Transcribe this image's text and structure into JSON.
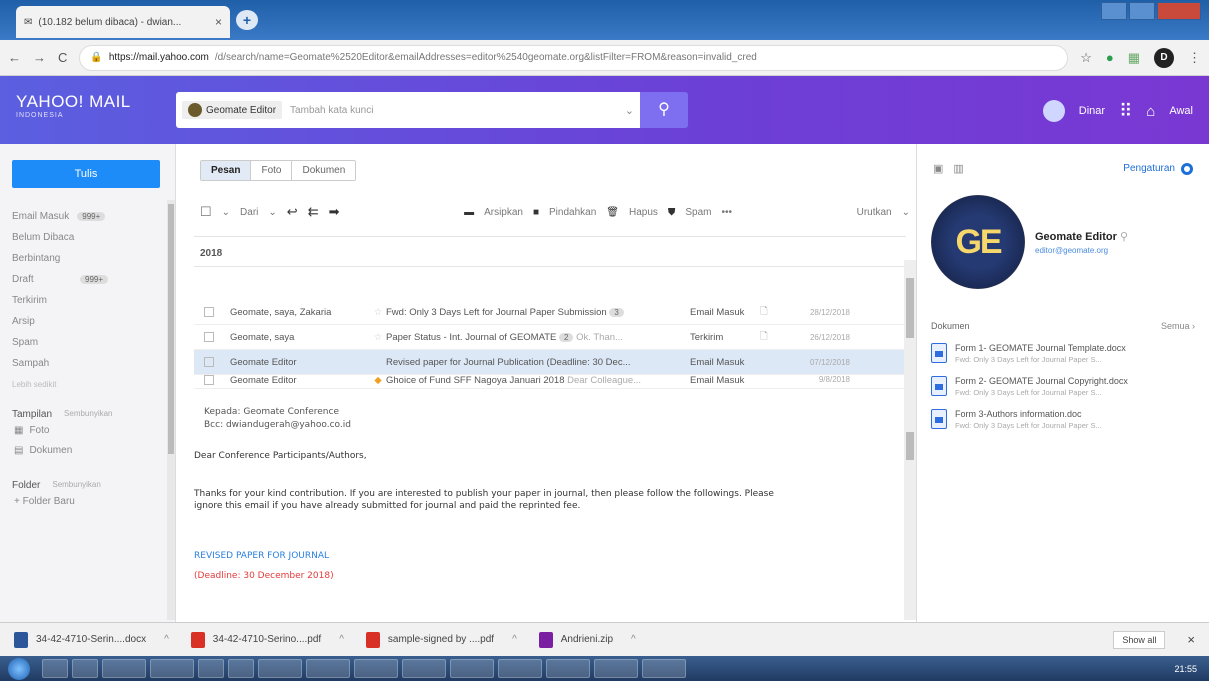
{
  "browser": {
    "tab_title": "(10.182 belum dibaca) - dwian...",
    "url_host": "https://mail.yahoo.com",
    "url_path": "/d/search/name=Geomate%2520Editor&emailAddresses=editor%2540geomate.org&listFilter=FROM&reason=invalid_cred",
    "profile_letter": "D"
  },
  "header": {
    "logo": "YAHOO! MAIL",
    "logo_sub": "INDONESIA",
    "search_chip": "Geomate Editor",
    "search_placeholder": "Tambah kata kunci",
    "user_name": "Dinar",
    "home_label": "Awal"
  },
  "sidebar": {
    "compose": "Tulis",
    "items": [
      {
        "label": "Email Masuk",
        "badge": "999+"
      },
      {
        "label": "Belum Dibaca",
        "badge": ""
      },
      {
        "label": "Berbintang",
        "badge": ""
      },
      {
        "label": "Draft",
        "badge": "999+"
      },
      {
        "label": "Terkirim",
        "badge": ""
      },
      {
        "label": "Arsip",
        "badge": ""
      },
      {
        "label": "Spam",
        "badge": ""
      },
      {
        "label": "Sampah",
        "badge": ""
      }
    ],
    "less": "Lebih sedikit",
    "views_title": "Tampilan",
    "views_hide": "Sembunyikan",
    "views": [
      "Foto",
      "Dokumen"
    ],
    "folders_title": "Folder",
    "folders_hide": "Sembunyikan",
    "new_folder": "+ Folder Baru"
  },
  "main": {
    "tabs": [
      "Pesan",
      "Foto",
      "Dokumen"
    ],
    "toolbar": {
      "from": "Dari",
      "archive": "Arsipkan",
      "move": "Pindahkan",
      "delete": "Hapus",
      "spam": "Spam",
      "more": "•••",
      "sort": "Urutkan"
    },
    "year": "2018",
    "messages": [
      {
        "from": "Geomate, saya, Zakaria",
        "starred": false,
        "subject": "Fwd: Only 3 Days Left for Journal Paper Submission",
        "count": "3",
        "snippet": "",
        "folder": "Email Masuk",
        "date": "28/12/2018"
      },
      {
        "from": "Geomate, saya",
        "starred": false,
        "subject": "Paper Status - Int. Journal of GEOMATE",
        "count": "2",
        "snippet": "Ok. Than...",
        "folder": "Terkirim",
        "date": "26/12/2018"
      },
      {
        "from": "Geomate Editor",
        "starred": false,
        "subject": "Revised paper for Journal Publication (Deadline: 30 Dec...",
        "count": "",
        "snippet": "",
        "folder": "Email Masuk",
        "date": "07/12/2018"
      },
      {
        "from": "Geomate Editor",
        "starred": true,
        "subject": "Ghoice of Fund SFF Nagoya Januari 2018",
        "count": "",
        "snippet": "Dear Colleague...",
        "folder": "Email Masuk",
        "date": "9/8/2018"
      }
    ],
    "reading": {
      "to": "Kepada: Geomate Conference",
      "bcc": "Bcc: dwiandugerah@yahoo.co.id",
      "greeting": "Dear Conference Participants/Authors,",
      "body1": "Thanks for your kind contribution. If you are interested to publish your paper in journal, then please follow the followings. Please",
      "body2": "ignore this email if you have already submitted for journal and paid the reprinted fee.",
      "heading": "REVISED PAPER FOR JOURNAL",
      "deadline": "(Deadline: 30 December 2018)"
    }
  },
  "right": {
    "settings": "Pengaturan",
    "logo_text": "GE",
    "contact_name": "Geomate Editor",
    "contact_email": "editor@geomate.org",
    "docs_title": "Dokumen",
    "docs_all": "Semua",
    "docs": [
      {
        "title": "Form 1- GEOMATE Journal Template.docx",
        "snippet": "Fwd: Only 3 Days Left for Journal Paper S..."
      },
      {
        "title": "Form 2- GEOMATE Journal Copyright.docx",
        "snippet": "Fwd: Only 3 Days Left for Journal Paper S..."
      },
      {
        "title": "Form 3-Authors information.doc",
        "snippet": "Fwd: Only 3 Days Left for Journal Paper S..."
      }
    ]
  },
  "downloads": {
    "items": [
      {
        "name": "34-42-4710-Serin....docx",
        "color": "#2b579a"
      },
      {
        "name": "34-42-4710-Serino....pdf",
        "color": "#d93025"
      },
      {
        "name": "sample-signed by ....pdf",
        "color": "#d93025"
      },
      {
        "name": "Andrieni.zip",
        "color": "#7a1fa2"
      }
    ],
    "show_all": "Show all"
  },
  "taskbar": {
    "clock": "21:55"
  }
}
